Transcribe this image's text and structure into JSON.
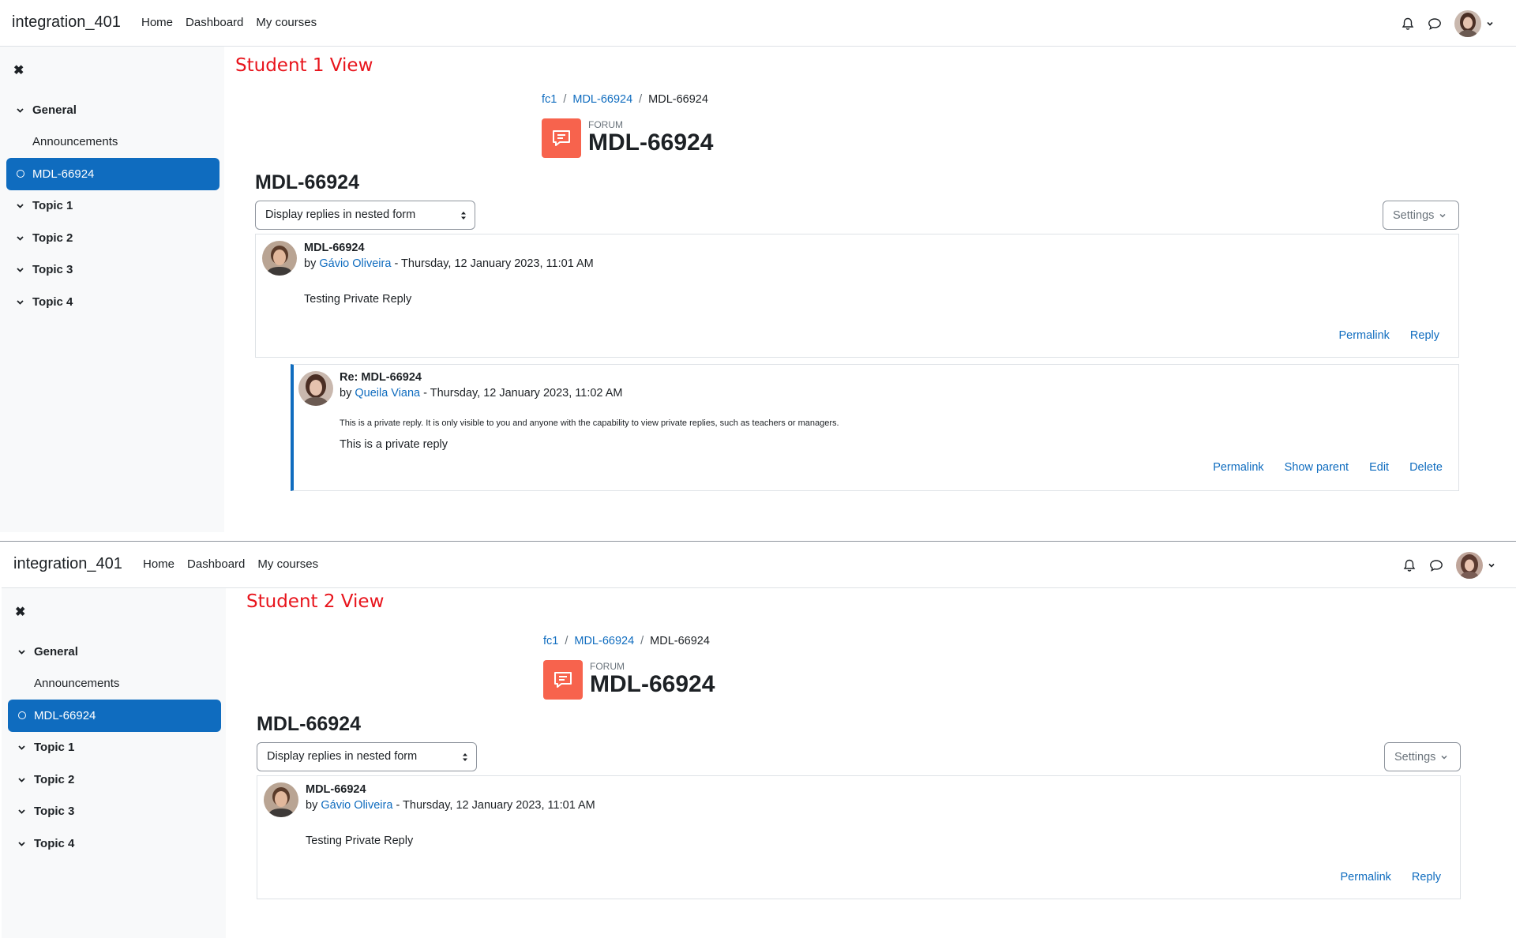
{
  "views": [
    {
      "label": "Student 1 View",
      "navbar": {
        "brand": "integration_401",
        "links": [
          "Home",
          "Dashboard",
          "My courses"
        ]
      },
      "drawer": {
        "close": "✖",
        "general": "General",
        "announcements": "Announcements",
        "active_item": "MDL-66924",
        "topics": [
          "Topic 1",
          "Topic 2",
          "Topic 3",
          "Topic 4"
        ]
      },
      "breadcrumb": [
        "fc1",
        "MDL-66924",
        "MDL-66924"
      ],
      "activity": {
        "type": "FORUM",
        "title": "MDL-66924"
      },
      "discussion_title": "MDL-66924",
      "display_mode": "Display replies in nested form",
      "settings_label": "Settings",
      "posts": [
        {
          "subject": "MDL-66924",
          "by": "by",
          "author": "Gávio Oliveira",
          "date": " - Thursday, 12 January 2023, 11:01 AM",
          "body": "Testing Private Reply",
          "actions": [
            "Permalink",
            "Reply"
          ]
        },
        {
          "subject": "Re: MDL-66924",
          "by": "by",
          "author": "Queila Viana",
          "date": " - Thursday, 12 January 2023, 11:02 AM",
          "private_note": "This is a private reply. It is only visible to you and anyone with the capability to view private replies, such as teachers or managers.",
          "body": "This is a private reply",
          "actions": [
            "Permalink",
            "Show parent",
            "Edit",
            "Delete"
          ]
        }
      ]
    },
    {
      "label": "Student 2 View",
      "navbar": {
        "brand": "integration_401",
        "links": [
          "Home",
          "Dashboard",
          "My courses"
        ]
      },
      "drawer": {
        "close": "✖",
        "general": "General",
        "announcements": "Announcements",
        "active_item": "MDL-66924",
        "topics": [
          "Topic 1",
          "Topic 2",
          "Topic 3",
          "Topic 4"
        ]
      },
      "breadcrumb": [
        "fc1",
        "MDL-66924",
        "MDL-66924"
      ],
      "activity": {
        "type": "FORUM",
        "title": "MDL-66924"
      },
      "discussion_title": "MDL-66924",
      "display_mode": "Display replies in nested form",
      "settings_label": "Settings",
      "posts": [
        {
          "subject": "MDL-66924",
          "by": "by",
          "author": "Gávio Oliveira",
          "date": " - Thursday, 12 January 2023, 11:01 AM",
          "body": "Testing Private Reply",
          "actions": [
            "Permalink",
            "Reply"
          ]
        }
      ]
    }
  ],
  "colors": {
    "primary": "#0f6cbf",
    "forum_icon": "#f7634d",
    "view_label": "#e8141c"
  }
}
